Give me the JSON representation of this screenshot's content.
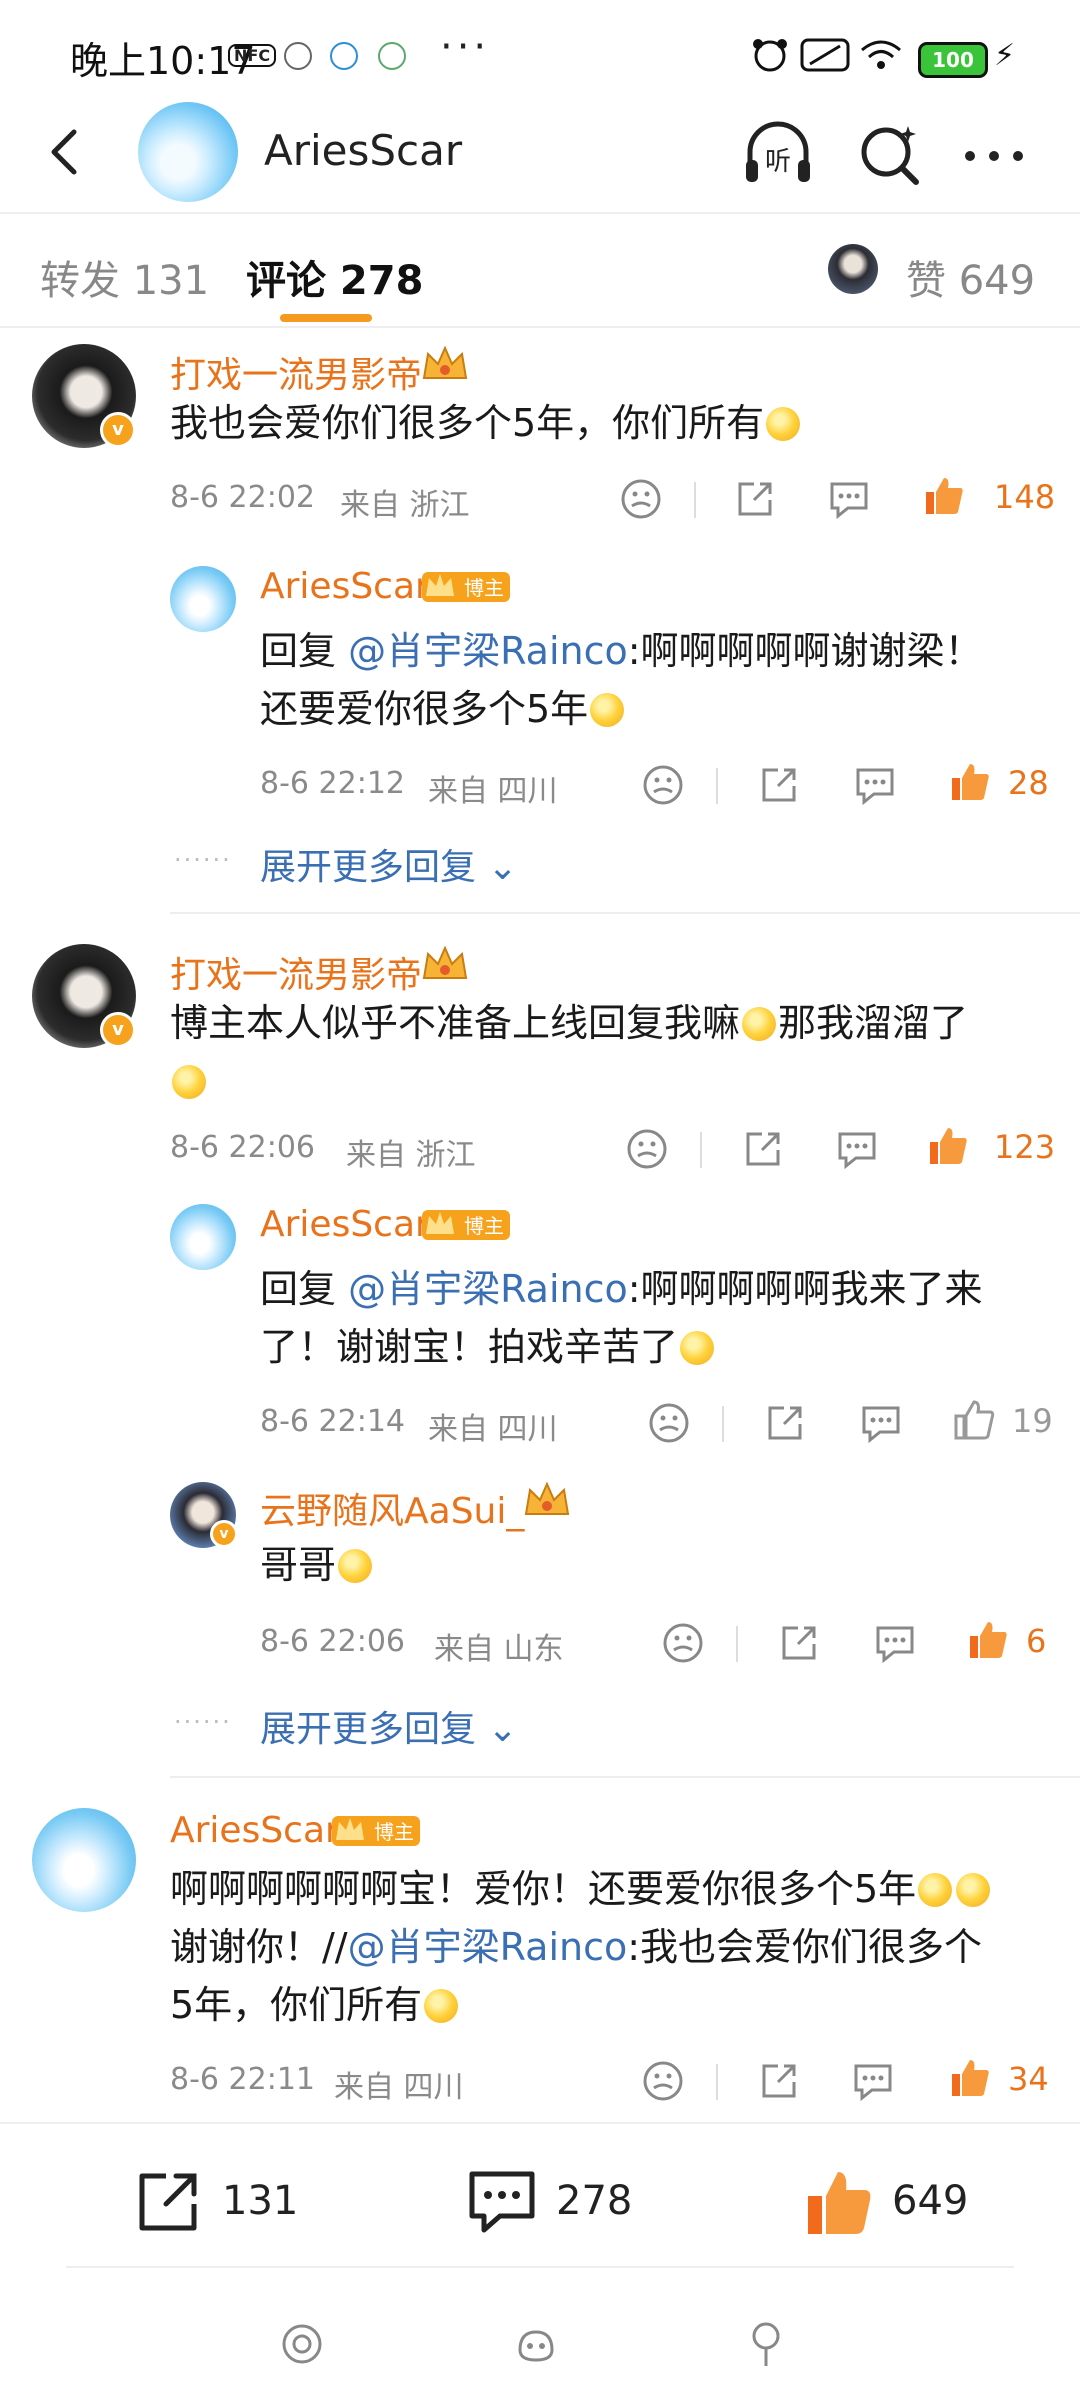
{
  "status_bar": {
    "time": "晚上10:17",
    "nfc": "NFC",
    "more": "···",
    "battery": "100"
  },
  "header": {
    "title": "AriesScar"
  },
  "tabs": {
    "repost": "转发 131",
    "comments": "评论 278",
    "likes": "赞 649"
  },
  "comments": [
    {
      "user": "打戏一流男影帝",
      "text": "我也会爱你们很多个5年，你们所有",
      "time": "8-6 22:02",
      "location": "来自 浙江",
      "likes": "148",
      "replies": [
        {
          "user": "AriesScar",
          "badge": "博主",
          "prefix": "回复 ",
          "mention": "@肖宇梁Rainco",
          "text_line1": ":啊啊啊啊啊谢谢梁！",
          "text_line2": "还要爱你很多个5年",
          "time": "8-6 22:12",
          "location": "来自 四川",
          "likes": "28"
        }
      ],
      "expand": "展开更多回复"
    },
    {
      "user": "打戏一流男影帝",
      "text_line1": "博主本人似乎不准备上线回复我嘛",
      "text_line1_tail": "那我溜溜了",
      "time": "8-6 22:06",
      "location": "来自 浙江",
      "likes": "123",
      "replies": [
        {
          "user": "AriesScar",
          "badge": "博主",
          "prefix": "回复 ",
          "mention": "@肖宇梁Rainco",
          "text_line1": ":啊啊啊啊啊我来了来",
          "text_line2": "了！谢谢宝！拍戏辛苦了",
          "time": "8-6 22:14",
          "location": "来自 四川",
          "likes": "19"
        },
        {
          "user": "云野随风AaSui_",
          "text": "哥哥",
          "time": "8-6 22:06",
          "location": "来自 山东",
          "likes": "6"
        }
      ],
      "expand": "展开更多回复"
    },
    {
      "user": "AriesScar",
      "badge": "博主",
      "text_line1": "啊啊啊啊啊啊宝！爱你！还要爱你很多个5年",
      "text_line2_prefix": "谢谢你！//",
      "mention": "@肖宇梁Rainco",
      "text_line2_tail": ":我也会爱你们很多个",
      "text_line3": "5年，你们所有",
      "time": "8-6 22:11",
      "location": "来自 四川",
      "likes": "34"
    }
  ],
  "bottom_bar": {
    "repost_count": "131",
    "comment_count": "278",
    "like_count": "649"
  },
  "colors": {
    "accent": "#e8731a",
    "link": "#3b6fb4",
    "tab_underline": "#f59a1c"
  },
  "icons": [
    "back-icon",
    "listen-icon",
    "search-ai-icon",
    "more-icon",
    "dislike-icon",
    "share-icon",
    "comment-icon",
    "like-icon",
    "crown-icon",
    "verified-icon"
  ]
}
